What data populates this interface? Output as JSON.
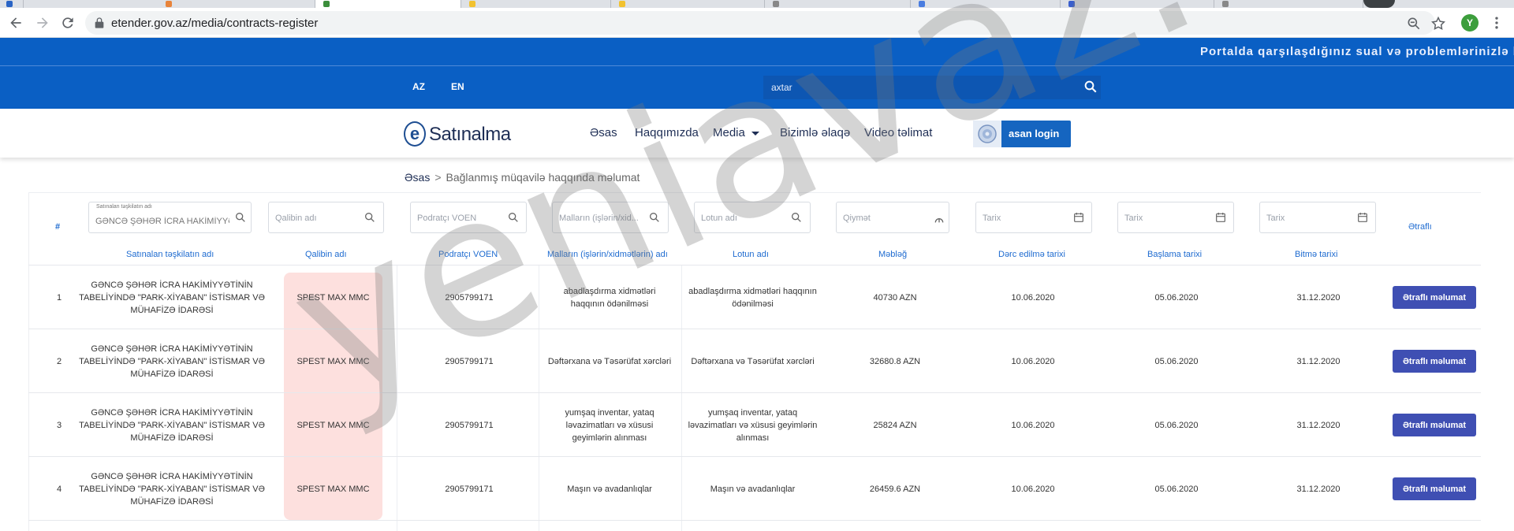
{
  "browser": {
    "url": "etender.gov.az/media/contracts-register",
    "profile_initial": "Y"
  },
  "site": {
    "top_notice": "Portalda qarşılaşdığınız sual və problemlərinizlə bağlı",
    "lang_az": "AZ",
    "lang_en": "EN",
    "search_placeholder": "axtar",
    "logo_letter": "e",
    "logo_text": "Satınalma",
    "nav": {
      "home": "Əsas",
      "about": "Haqqımızda",
      "media": "Media",
      "contact": "Bizimlə əlaqə",
      "video": "Video təlimat",
      "login": "asan login"
    },
    "colors": {
      "header_blue": "#0a5fc4",
      "button_indigo": "#3f4fb3",
      "highlight_pink": "#fde0de"
    }
  },
  "breadcrumb": {
    "home": "Əsas",
    "separator": ">",
    "current": "Bağlanmış müqavilə haqqında məlumat"
  },
  "filters": {
    "org_label": "Satınalan təşkilatın adı",
    "org_value": "GƏNCƏ ŞƏHƏR İCRA HAKİMİYYƏTİ",
    "template": "Qalibin adı",
    "voen": "Podratçı VOEN",
    "goods": "Malların (işlərin/xid...",
    "lot": "Lotun adı",
    "price": "Qiymət",
    "date1": "Tarix",
    "date2": "Tarix",
    "date3": "Tarix"
  },
  "table": {
    "hash": "#",
    "more_head": "Ətraflı",
    "headers": [
      "Satınalan təşkilatın adı",
      "Qalibin adı",
      "Podratçı VOEN",
      "Malların (işlərin/xidmətlərin) adı",
      "Lotun adı",
      "Məbləğ",
      "Dərc edilmə tarixi",
      "Başlama tarixi",
      "Bitmə tarixi"
    ],
    "more_label": "Ətraflı məlumat",
    "rows": [
      {
        "n": "1",
        "org": "GƏNCƏ ŞƏHƏR İCRA HAKİMİYYƏTİNİN TABELİYİNDƏ \"PARK-XİYABAN\" İSTİSMAR VƏ MÜHAFİZƏ İDARƏSİ",
        "winner": "SPEST MAX MMC",
        "voen": "2905799171",
        "goods": "abadlaşdırma xidmətləri haqqının ödənilməsi",
        "lot": "abadlaşdırma xidmətləri haqqının ödənilməsi",
        "amount": "40730 AZN",
        "published": "10.06.2020",
        "start": "05.06.2020",
        "end": "31.12.2020"
      },
      {
        "n": "2",
        "org": "GƏNCƏ ŞƏHƏR İCRA HAKİMİYYƏTİNİN TABELİYİNDƏ \"PARK-XİYABAN\" İSTİSMAR VƏ MÜHAFİZƏ İDARƏSİ",
        "winner": "SPEST MAX MMC",
        "voen": "2905799171",
        "goods": "Dəftərxana və Təsərüfat xərcləri",
        "lot": "Dəftərxana və Təsərüfat xərcləri",
        "amount": "32680.8 AZN",
        "published": "10.06.2020",
        "start": "05.06.2020",
        "end": "31.12.2020"
      },
      {
        "n": "3",
        "org": "GƏNCƏ ŞƏHƏR İCRA HAKİMİYYƏTİNİN TABELİYİNDƏ \"PARK-XİYABAN\" İSTİSMAR VƏ MÜHAFİZƏ İDARƏSİ",
        "winner": "SPEST MAX MMC",
        "voen": "2905799171",
        "goods": "yumşaq inventar, yataq ləvazimatları və xüsusi geyimlərin alınması",
        "lot": "yumşaq inventar, yataq ləvazimatları və xüsusi geyimlərin alınması",
        "amount": "25824 AZN",
        "published": "10.06.2020",
        "start": "05.06.2020",
        "end": "31.12.2020"
      },
      {
        "n": "4",
        "org": "GƏNCƏ ŞƏHƏR İCRA HAKİMİYYƏTİNİN TABELİYİNDƏ \"PARK-XİYABAN\" İSTİSMAR VƏ MÜHAFİZƏ İDARƏSİ",
        "winner": "SPEST MAX MMC",
        "voen": "2905799171",
        "goods": "Maşın və avadanlıqlar",
        "lot": "Maşın və avadanlıqlar",
        "amount": "26459.6 AZN",
        "published": "10.06.2020",
        "start": "05.06.2020",
        "end": "31.12.2020"
      }
    ]
  },
  "watermark": "yeniavaz.com"
}
